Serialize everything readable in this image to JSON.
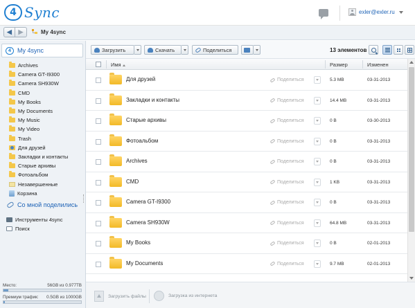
{
  "header": {
    "logo_badge": "4",
    "logo_text": "Sync",
    "user_email": "exler@exler.ru"
  },
  "nav": {
    "title": "My 4sync"
  },
  "sidebar": {
    "head": "My 4sync",
    "items": [
      {
        "label": "Archives",
        "icon": "folder-icon"
      },
      {
        "label": "Camera GT-I9300",
        "icon": "folder-icon"
      },
      {
        "label": "Camera SH930W",
        "icon": "folder-icon"
      },
      {
        "label": "CMD",
        "icon": "folder-icon"
      },
      {
        "label": "My Books",
        "icon": "folder-icon"
      },
      {
        "label": "My Documents",
        "icon": "folder-icon"
      },
      {
        "label": "My Music",
        "icon": "folder-icon"
      },
      {
        "label": "My Video",
        "icon": "folder-icon"
      },
      {
        "label": "Trash",
        "icon": "folder-icon"
      },
      {
        "label": "Для друзей",
        "icon": "shared-folder-icon"
      },
      {
        "label": "Закладки и контакты",
        "icon": "folder-icon"
      },
      {
        "label": "Старые архивы",
        "icon": "folder-icon"
      },
      {
        "label": "Фотоальбом",
        "icon": "folder-icon"
      },
      {
        "label": "Незавершенные",
        "icon": "unsorted-icon"
      },
      {
        "label": "Корзина",
        "icon": "recycle-bin-icon"
      }
    ],
    "shared_head": "Со мной поделились",
    "tools": [
      {
        "label": "Инструменты 4sync",
        "icon": "tools-icon"
      },
      {
        "label": "Поиск",
        "icon": "search-icon"
      }
    ],
    "storage": {
      "space_label": "Место:",
      "space_value": "56GB из 0.977TB",
      "space_fraction": 0.06,
      "traffic_label": "Премиум трафик:",
      "traffic_value": "0.5GB из 1000GB",
      "traffic_fraction": 0.0005
    }
  },
  "toolbar": {
    "upload_label": "Загрузить",
    "download_label": "Скачать",
    "share_label": "Поделиться",
    "count_label": "13 элементов"
  },
  "table": {
    "col_name": "Имя",
    "col_size": "Размер",
    "col_modified": "Изменен",
    "share_label": "Поделиться",
    "rows": [
      {
        "name": "Для друзей",
        "size": "5.3 MB",
        "date": "03-31-2013"
      },
      {
        "name": "Закладки и контакты",
        "size": "14.4 MB",
        "date": "03-31-2013"
      },
      {
        "name": "Старые архивы",
        "size": "0 B",
        "date": "03-30-2013"
      },
      {
        "name": "Фотоальбом",
        "size": "0 B",
        "date": "03-31-2013"
      },
      {
        "name": "Archives",
        "size": "0 B",
        "date": "03-31-2013"
      },
      {
        "name": "CMD",
        "size": "1 KB",
        "date": "03-31-2013"
      },
      {
        "name": "Camera GT-I9300",
        "size": "0 B",
        "date": "03-31-2013"
      },
      {
        "name": "Camera SH930W",
        "size": "64.8 MB",
        "date": "03-31-2013"
      },
      {
        "name": "My Books",
        "size": "0 B",
        "date": "02-01-2013"
      },
      {
        "name": "My Documents",
        "size": "9.7 MB",
        "date": "02-01-2013"
      }
    ]
  },
  "footer": {
    "upload_files": "Загрузить файлы",
    "upload_internet": "Загрузка из интернета"
  },
  "colors": {
    "accent": "#1f7fd1",
    "link": "#1e63b6",
    "folder": "#f4c74a"
  }
}
